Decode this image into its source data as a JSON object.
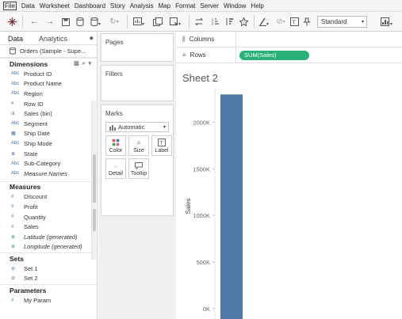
{
  "menu": [
    "File",
    "Data",
    "Worksheet",
    "Dashboard",
    "Story",
    "Analysis",
    "Map",
    "Format",
    "Server",
    "Window",
    "Help"
  ],
  "toolbar": {
    "fit_label": "Standard"
  },
  "left": {
    "tabs": [
      "Data",
      "Analytics"
    ],
    "datasource": "Orders (Sample - Supe...",
    "dimensions_title": "Dimensions",
    "dimensions": [
      {
        "icon": "Abc",
        "label": "Product ID"
      },
      {
        "icon": "Abc",
        "label": "Product Name"
      },
      {
        "icon": "Abc",
        "label": "Region"
      },
      {
        "icon": "#",
        "label": "Row ID"
      },
      {
        "icon": "ılı",
        "label": "Sales (bin)"
      },
      {
        "icon": "Abc",
        "label": "Segment"
      },
      {
        "icon": "▦",
        "label": "Ship Date"
      },
      {
        "icon": "Abc",
        "label": "Ship Mode"
      },
      {
        "icon": "⊕",
        "label": "State"
      },
      {
        "icon": "Abc",
        "label": "Sub-Category"
      },
      {
        "icon": "Abc",
        "label": "Measure Names"
      }
    ],
    "measures_title": "Measures",
    "measures": [
      {
        "icon": "#",
        "label": "Discount"
      },
      {
        "icon": "#",
        "label": "Profit"
      },
      {
        "icon": "#",
        "label": "Quantity"
      },
      {
        "icon": "#",
        "label": "Sales"
      },
      {
        "icon": "⊕",
        "label": "Latitude (generated)"
      },
      {
        "icon": "⊕",
        "label": "Longitude (generated)"
      }
    ],
    "sets_title": "Sets",
    "sets": [
      {
        "icon": "⊘",
        "label": "Set 1"
      },
      {
        "icon": "⊘",
        "label": "Set 2"
      }
    ],
    "params_title": "Parameters",
    "params": [
      {
        "icon": "#",
        "label": "My Param"
      }
    ]
  },
  "cards": {
    "pages": "Pages",
    "filters": "Filters",
    "marks": "Marks",
    "mark_type": "Automatic",
    "buttons": [
      "Color",
      "Size",
      "Label",
      "Detail",
      "Tooltip"
    ]
  },
  "shelves": {
    "columns_label": "Columns",
    "rows_label": "Rows",
    "rows_pill": "SUM(Sales)"
  },
  "sheet": {
    "title": "Sheet 2"
  },
  "chart_data": {
    "type": "bar",
    "categories": [
      ""
    ],
    "values": [
      2297201
    ],
    "ylabel": "Sales",
    "xlabel": "",
    "ylim": [
      0,
      2300000
    ],
    "yticks": [
      0,
      500000,
      1000000,
      1500000,
      2000000
    ],
    "ytick_labels": [
      "0K",
      "500K",
      "1000K",
      "1500K",
      "2000K"
    ],
    "bar_color": "#4e79a7",
    "grid": false
  }
}
